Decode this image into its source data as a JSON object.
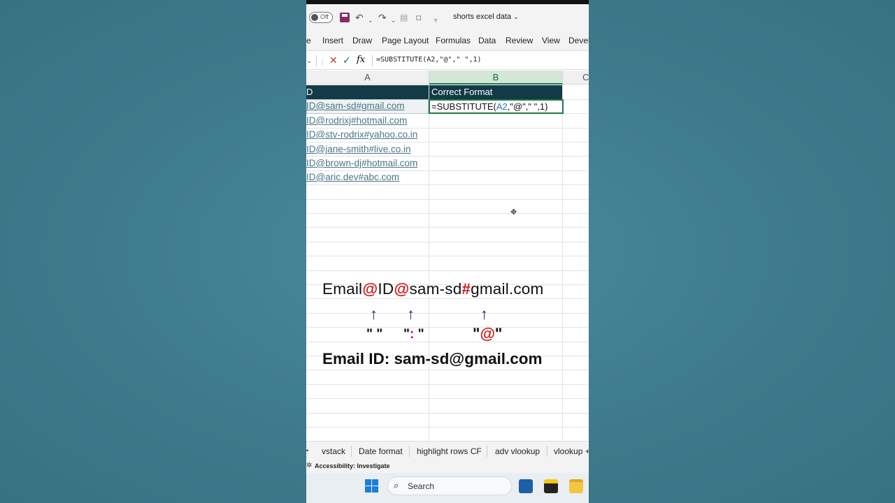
{
  "toolbar": {
    "autosave_label": "Off",
    "document_title": "shorts excel data"
  },
  "ribbon": {
    "tabs": [
      "e",
      "Insert",
      "Draw",
      "Page Layout",
      "Formulas",
      "Data",
      "Review",
      "View",
      "Devel"
    ]
  },
  "formula_bar": {
    "fx_label": "fx",
    "formula": "=SUBSTITUTE(A2,\"@\",\" \",1)"
  },
  "grid": {
    "columns": [
      "A",
      "B",
      "C"
    ],
    "header_a": "D",
    "header_b": "Correct Format",
    "emails": [
      "ID@sam-sd#gmail.com",
      "ID@rodrixj#hotmail.com",
      "ID@stv-rodrix#yahoo.co.in",
      "ID@jane-smith#live.co.in",
      "ID@brown-dj#hotmail.com",
      "ID@aric.dev#abc.com"
    ],
    "active_cell": {
      "prefix": "=SUBSTITUTE(",
      "ref": "A2",
      "suffix": ",\"@\",\" \",1)"
    }
  },
  "annotation": {
    "seg1": "Email",
    "at1": "@",
    "seg2": "ID",
    "at2": "@",
    "seg3": "sam-sd",
    "hash": "#",
    "seg4": "gmail.com",
    "arrow": "↑",
    "quote_space": "\" \"",
    "quote_colon_open": "\"",
    "quote_colon": ":",
    "quote_colon_close": " \"",
    "quote_at_open": "\"",
    "quote_at": "@",
    "quote_at_close": "\"",
    "result": "Email ID: sam-sd@gmail.com"
  },
  "sheet_tabs": [
    "vstack",
    "Date format",
    "highlight rows CF",
    "adv vlookup",
    "vlookup +"
  ],
  "status": {
    "accessibility": "Accessibility: Investigate"
  },
  "taskbar": {
    "search_label": "Search"
  },
  "colors": {
    "header_fill": "#123a47",
    "accent_green": "#1e7b45",
    "highlight_red": "#d01818",
    "arrow_blue": "#1b2a6b",
    "background": "#3f7d8e"
  }
}
